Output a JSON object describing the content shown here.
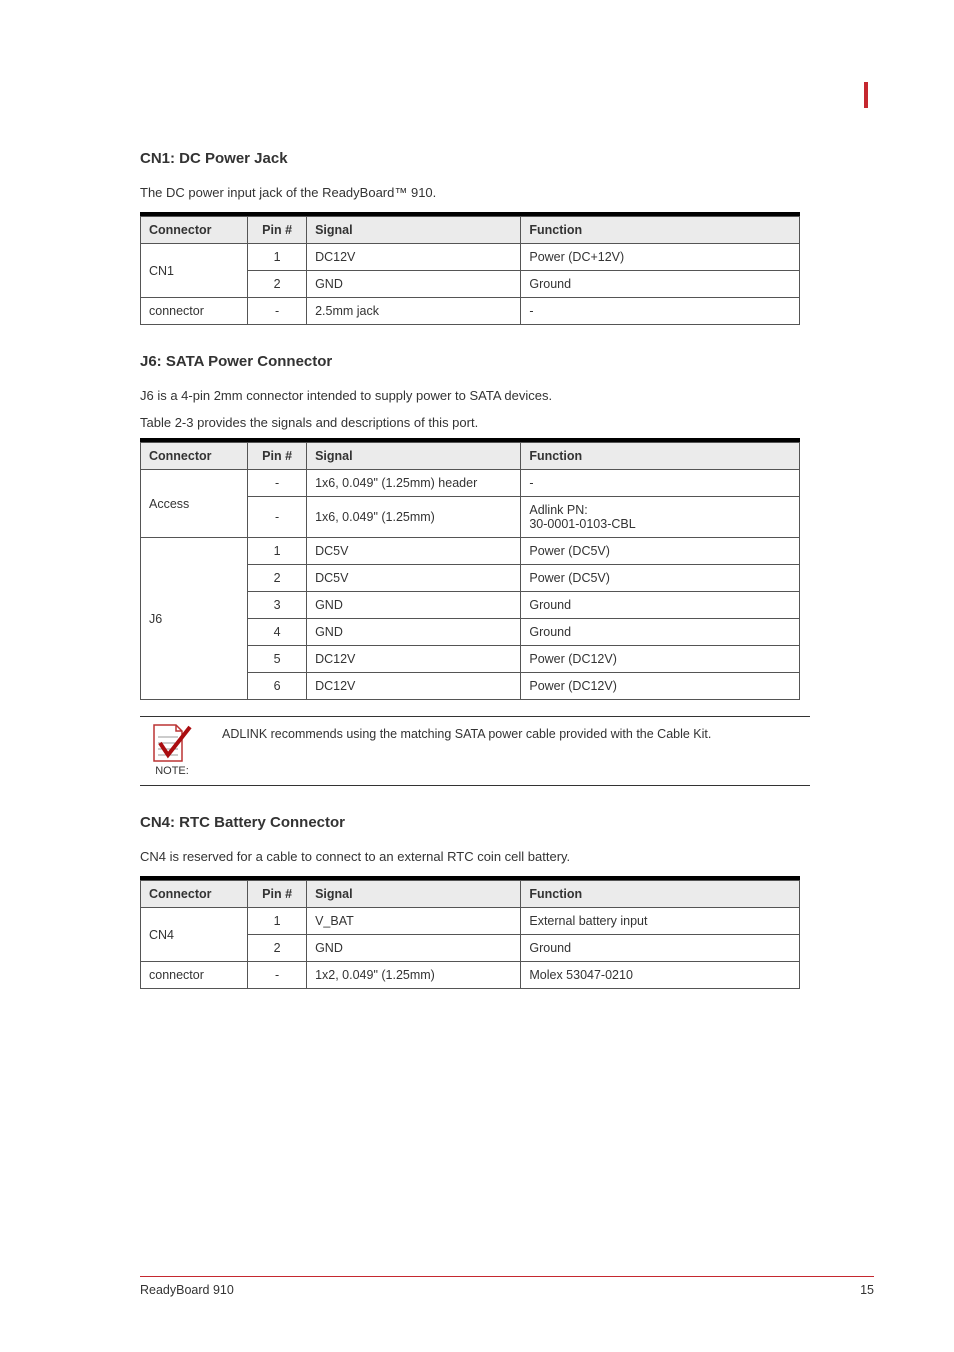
{
  "pageMarker": true,
  "sections": [
    {
      "id": "cn1",
      "title": "CN1: DC Power Jack",
      "desc": "The DC power input jack of the ReadyBoard™ 910.",
      "table": {
        "headers": [
          "Connector",
          "Pin #",
          "Signal",
          "Function"
        ],
        "rows": [
          {
            "connector": "CN1",
            "connectorRowspan": 2,
            "pin": "1",
            "signal": "DC12V",
            "function": "Power (DC+12V)"
          },
          {
            "pin": "2",
            "signal": "GND",
            "function": "Ground"
          },
          {
            "connector": "connector",
            "pin": "-",
            "signal": "2.5mm jack",
            "function": "-"
          }
        ]
      }
    },
    {
      "id": "j6",
      "title": "J6: SATA Power Connector",
      "desc": "J6 is a 4-pin 2mm connector intended to supply power to SATA devices.",
      "sub": "Table 2-3 provides the signals and descriptions of this port.",
      "table": {
        "headers": [
          "Connector",
          "Pin #",
          "Signal",
          "Function"
        ],
        "rows": [
          {
            "connector": "Access",
            "connectorRowspan": 2,
            "pin": "-",
            "signal": "1x6, 0.049\" (1.25mm) header",
            "function": "-"
          },
          {
            "pin": "-",
            "signal": "1x6, 0.049\" (1.25mm)",
            "function": "Adlink PN:\n30-0001-0103-CBL"
          },
          {
            "connector": "J6",
            "connectorRowspan": 6,
            "pin": "1",
            "signal": "DC5V",
            "function": "Power (DC5V)"
          },
          {
            "pin": "2",
            "signal": "DC5V",
            "function": "Power (DC5V)"
          },
          {
            "pin": "3",
            "signal": "GND",
            "function": "Ground"
          },
          {
            "pin": "4",
            "signal": "GND",
            "function": "Ground"
          },
          {
            "pin": "5",
            "signal": "DC12V",
            "function": "Power (DC12V)"
          },
          {
            "pin": "6",
            "signal": "DC12V",
            "function": "Power (DC12V)"
          }
        ]
      },
      "note": {
        "label": "NOTE:",
        "text": "ADLINK recommends using the matching SATA power cable provided with the Cable Kit."
      }
    },
    {
      "id": "cn4",
      "title": "CN4: RTC Battery Connector",
      "desc": "CN4 is reserved for a cable to connect to an external RTC coin cell battery.",
      "table": {
        "headers": [
          "Connector",
          "Pin #",
          "Signal",
          "Function"
        ],
        "rows": [
          {
            "connector": "CN4",
            "connectorRowspan": 2,
            "pin": "1",
            "signal": "V_BAT",
            "function": "External battery input"
          },
          {
            "pin": "2",
            "signal": "GND",
            "function": "Ground"
          },
          {
            "connector": "connector",
            "pin": "-",
            "signal": "1x2, 0.049\" (1.25mm)",
            "function": "Molex 53047-0210"
          }
        ]
      }
    }
  ],
  "footer": {
    "left": "ReadyBoard 910",
    "right": "15"
  }
}
